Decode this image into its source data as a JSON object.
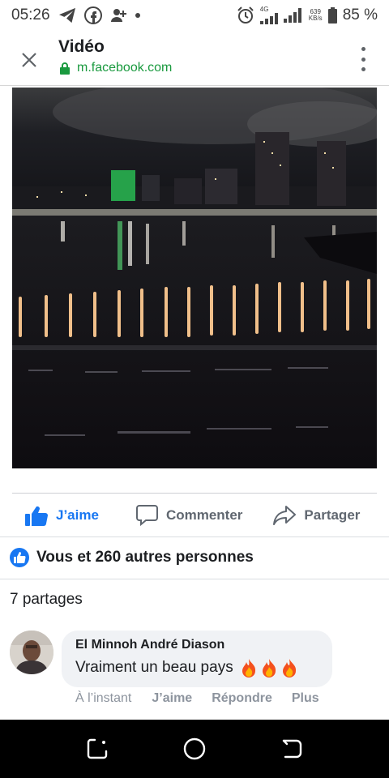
{
  "status_bar": {
    "time": "05:26",
    "network_type": "4G",
    "data_speed_value": "639",
    "data_speed_unit": "KB/s",
    "battery_percent": "85 %"
  },
  "header": {
    "title": "Vidéo",
    "url": "m.facebook.com"
  },
  "actions": {
    "like_label": "J’aime",
    "comment_label": "Commenter",
    "share_label": "Partager"
  },
  "reactions": {
    "summary": "Vous et 260 autres personnes"
  },
  "shares": {
    "count_text": "7 partages"
  },
  "comment": {
    "author": "El Minnoh André Diason",
    "text": "Vraiment un beau pays",
    "emoji_icons": [
      "fire-icon",
      "fire-icon",
      "fire-icon"
    ],
    "time": "À l’instant",
    "like_label": "J’aime",
    "reply_label": "Répondre",
    "more_label": "Plus"
  },
  "colors": {
    "facebook_blue": "#1877f2",
    "secure_green": "#1a9a3f",
    "muted_text": "#606770"
  }
}
